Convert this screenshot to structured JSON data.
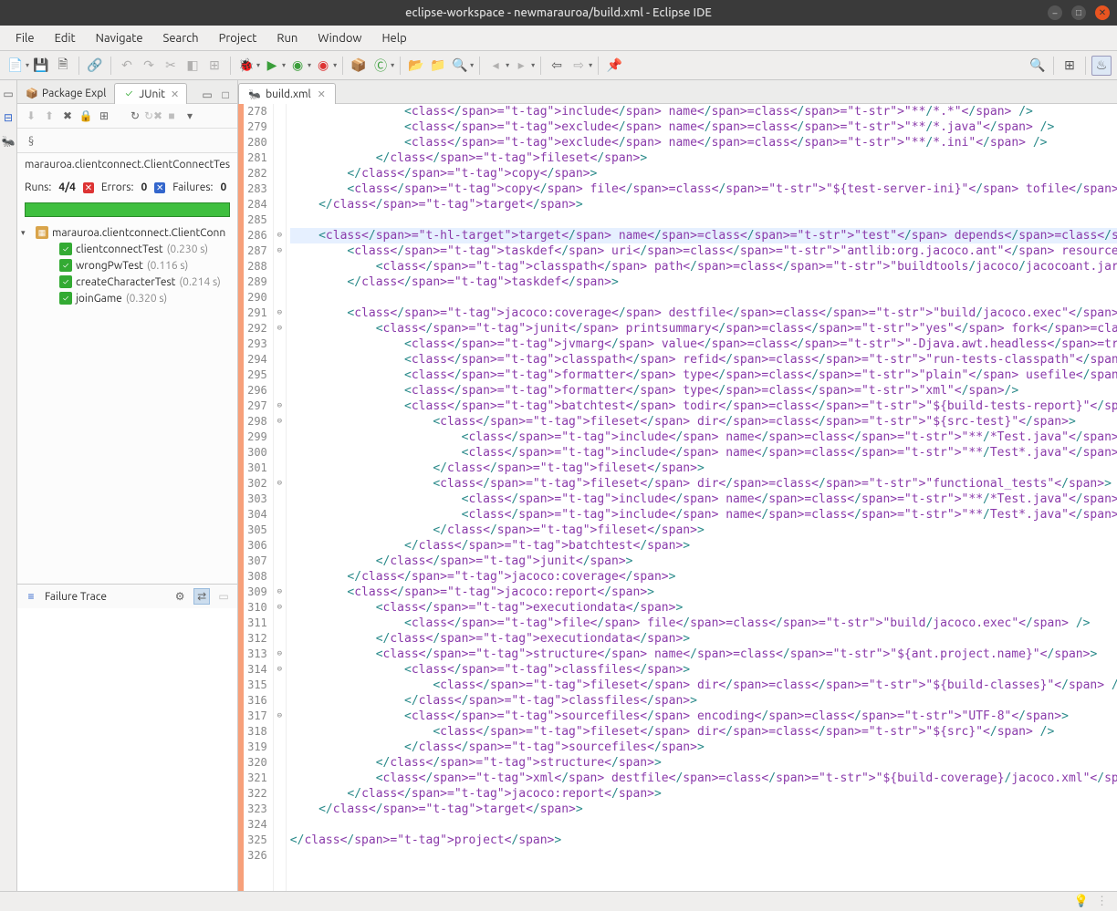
{
  "title": "eclipse-workspace - newmarauroa/build.xml - Eclipse IDE",
  "menu": [
    "File",
    "Edit",
    "Navigate",
    "Search",
    "Project",
    "Run",
    "Window",
    "Help"
  ],
  "left_tabs": {
    "pkg": "Package Expl",
    "junit": "JUnit"
  },
  "junit": {
    "path": "marauroa.clientconnect.ClientConnectTes",
    "runs_label": "Runs:",
    "runs": "4/4",
    "errors_label": "Errors:",
    "errors": "0",
    "failures_label": "Failures:",
    "failures": "0",
    "root": "marauroa.clientconnect.ClientConn",
    "tests": [
      {
        "name": "clientconnectTest",
        "time": "(0.230 s)"
      },
      {
        "name": "wrongPwTest",
        "time": "(0.116 s)"
      },
      {
        "name": "createCharacterTest",
        "time": "(0.214 s)"
      },
      {
        "name": "joinGame",
        "time": "(0.320 s)"
      }
    ],
    "failure_trace": "Failure Trace"
  },
  "editor": {
    "tab": "build.xml",
    "first_line": 278,
    "fold_marks": {
      "286": "⊖",
      "287": "⊖",
      "291": "⊖",
      "292": "⊖",
      "297": "⊖",
      "298": "⊖",
      "302": "⊖",
      "309": "⊖",
      "310": "⊖",
      "313": "⊖",
      "314": "⊖",
      "317": "⊖"
    },
    "lines": [
      {
        "n": 278,
        "t": "                <include name=\"**/*.*\" />"
      },
      {
        "n": 279,
        "t": "                <exclude name=\"**/*.java\" />"
      },
      {
        "n": 280,
        "t": "                <exclude name=\"**/*.ini\" />"
      },
      {
        "n": 281,
        "t": "            </fileset>"
      },
      {
        "n": 282,
        "t": "        </copy>"
      },
      {
        "n": 283,
        "t": "        <copy file=\"${test-server-ini}\" tofile=\"./server.ini\" />"
      },
      {
        "n": 284,
        "t": "    </target>"
      },
      {
        "n": 285,
        "t": ""
      },
      {
        "n": 286,
        "t": "    <target name=\"test\" depends=\"compile-tests\">",
        "hl": true,
        "tgt": true
      },
      {
        "n": 287,
        "t": "        <taskdef uri=\"antlib:org.jacoco.ant\" resource=\"org/jacoco/ant/antlib.xml\">"
      },
      {
        "n": 288,
        "t": "            <classpath path=\"buildtools/jacoco/jacocoant.jar\"/>"
      },
      {
        "n": 289,
        "t": "        </taskdef>"
      },
      {
        "n": 290,
        "t": ""
      },
      {
        "n": 291,
        "t": "        <jacoco:coverage destfile=\"build/jacoco.exec\" append=\"false\">"
      },
      {
        "n": 292,
        "t": "            <junit printsummary=\"yes\" fork=\"yes\" forkmode=\"once\" haltonerror=\"true\" haltonfailure="
      },
      {
        "n": 293,
        "t": "                <jvmarg value=\"-Djava.awt.headless=true\"/>"
      },
      {
        "n": 294,
        "t": "                <classpath refid=\"run-tests-classpath\" />"
      },
      {
        "n": 295,
        "t": "                <formatter type=\"plain\" usefile=\"false\"/>"
      },
      {
        "n": 296,
        "t": "                <formatter type=\"xml\"/>"
      },
      {
        "n": 297,
        "t": "                <batchtest todir=\"${build-tests-report}\">"
      },
      {
        "n": 298,
        "t": "                    <fileset dir=\"${src-test}\">"
      },
      {
        "n": 299,
        "t": "                        <include name=\"**/*Test.java\"/>"
      },
      {
        "n": 300,
        "t": "                        <include name=\"**/Test*.java\"/>"
      },
      {
        "n": 301,
        "t": "                    </fileset>"
      },
      {
        "n": 302,
        "t": "                    <fileset dir=\"functional_tests\">"
      },
      {
        "n": 303,
        "t": "                        <include name=\"**/*Test.java\"/>"
      },
      {
        "n": 304,
        "t": "                        <include name=\"**/Test*.java\"/>"
      },
      {
        "n": 305,
        "t": "                    </fileset>"
      },
      {
        "n": 306,
        "t": "                </batchtest>"
      },
      {
        "n": 307,
        "t": "            </junit>"
      },
      {
        "n": 308,
        "t": "        </jacoco:coverage>"
      },
      {
        "n": 309,
        "t": "        <jacoco:report>"
      },
      {
        "n": 310,
        "t": "            <executiondata>"
      },
      {
        "n": 311,
        "t": "                <file file=\"build/jacoco.exec\" />"
      },
      {
        "n": 312,
        "t": "            </executiondata>"
      },
      {
        "n": 313,
        "t": "            <structure name=\"${ant.project.name}\">"
      },
      {
        "n": 314,
        "t": "                <classfiles>"
      },
      {
        "n": 315,
        "t": "                    <fileset dir=\"${build-classes}\" />"
      },
      {
        "n": 316,
        "t": "                </classfiles>"
      },
      {
        "n": 317,
        "t": "                <sourcefiles encoding=\"UTF-8\">"
      },
      {
        "n": 318,
        "t": "                    <fileset dir=\"${src}\" />"
      },
      {
        "n": 319,
        "t": "                </sourcefiles>"
      },
      {
        "n": 320,
        "t": "            </structure>"
      },
      {
        "n": 321,
        "t": "            <xml destfile=\"${build-coverage}/jacoco.xml\" />"
      },
      {
        "n": 322,
        "t": "        </jacoco:report>"
      },
      {
        "n": 323,
        "t": "    </target>"
      },
      {
        "n": 324,
        "t": ""
      },
      {
        "n": 325,
        "t": "</project>"
      },
      {
        "n": 326,
        "t": ""
      }
    ]
  }
}
